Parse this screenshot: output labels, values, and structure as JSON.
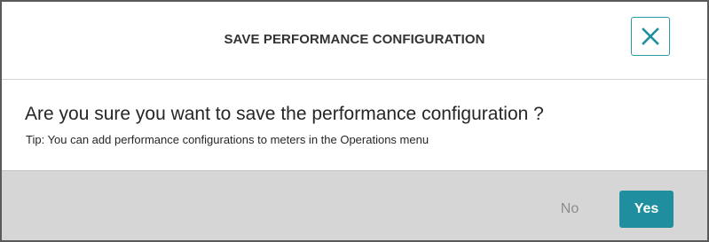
{
  "dialog": {
    "title": "SAVE PERFORMANCE CONFIGURATION",
    "close_icon": "close-icon",
    "message": "Are you sure you want to save the performance configuration ?",
    "tip": "Tip: You can add performance configurations to meters in the Operations menu",
    "buttons": {
      "no_label": "No",
      "yes_label": "Yes"
    }
  },
  "colors": {
    "accent": "#1f8f9f",
    "footer_background": "#d6d6d6",
    "disabled_text": "#8c8c8c"
  }
}
